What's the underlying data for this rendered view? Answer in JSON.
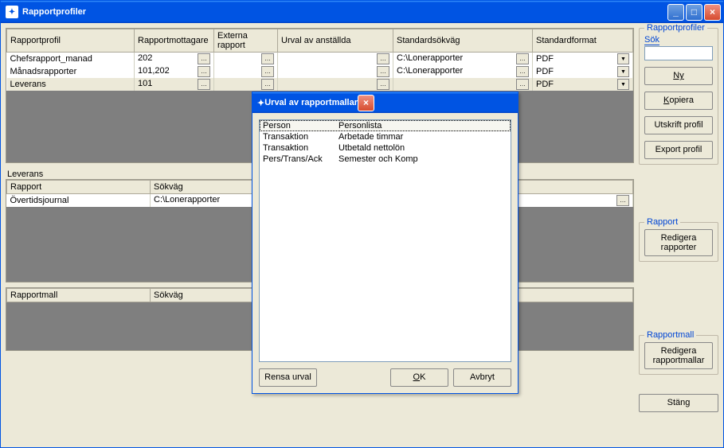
{
  "window": {
    "title": "Rapportprofiler"
  },
  "grid1": {
    "headers": [
      "Rapportprofil",
      "Rapportmottagare",
      "Externa rapport",
      "Urval av anställda",
      "Standardsökväg",
      "Standardformat"
    ],
    "rows": [
      {
        "profil": "Chefsrapport_manad",
        "mottagare": "202",
        "extern": "",
        "urval": "",
        "sokvag": "C:\\Lonerapporter",
        "format": "PDF"
      },
      {
        "profil": "Månadsrapporter",
        "mottagare": "101,202",
        "extern": "",
        "urval": "",
        "sokvag": "C:\\Lonerapporter",
        "format": "PDF"
      },
      {
        "profil": "Leverans",
        "mottagare": "101",
        "extern": "",
        "urval": "",
        "sokvag": "",
        "format": "PDF",
        "sel": true
      }
    ]
  },
  "section2": {
    "label": "Leverans",
    "headers": [
      "Rapport",
      "Sökväg"
    ],
    "rows": [
      {
        "rapport": "Övertidsjournal",
        "sokvag": "C:\\Lonerapporter"
      }
    ]
  },
  "section3": {
    "headers": [
      "Rapportmall",
      "Sökväg"
    ]
  },
  "right": {
    "g1": {
      "legend": "Rapportprofiler",
      "sok": "Sök",
      "ny": "Ny",
      "kopiera": "Kopiera",
      "utskrift": "Utskrift profil",
      "export": "Export profil"
    },
    "g2": {
      "legend": "Rapport",
      "redigera": "Redigera rapporter"
    },
    "g3": {
      "legend": "Rapportmall",
      "redigera": "Redigera rapportmallar"
    },
    "stang": "Stäng"
  },
  "modal": {
    "title": "Urval av rapportmallar",
    "rows": [
      {
        "c1": "Person",
        "c2": "Personlista",
        "sel": true
      },
      {
        "c1": "Transaktion",
        "c2": "Arbetade timmar"
      },
      {
        "c1": "Transaktion",
        "c2": "Utbetald nettolön"
      },
      {
        "c1": "Pers/Trans/Ack",
        "c2": "Semester och Komp"
      }
    ],
    "rensa": "Rensa urval",
    "ok": "OK",
    "avbryt": "Avbryt"
  }
}
